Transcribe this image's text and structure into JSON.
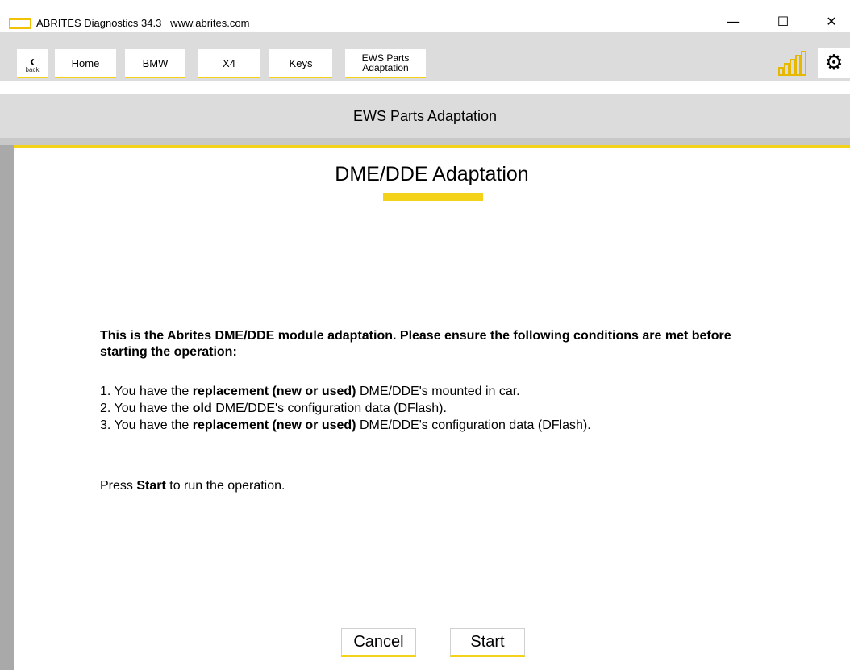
{
  "window": {
    "title": "ABRITES Diagnostics 34.3   www.abrites.com",
    "minimize": "—",
    "maximize": "☐",
    "close": "✕"
  },
  "nav": {
    "back_label": "back",
    "items": [
      "Home",
      "BMW",
      "X4",
      "Keys",
      "EWS Parts Adaptation"
    ],
    "ews_line1": "EWS Parts",
    "ews_line2": "Adaptation",
    "accent_color": "#f5d21a"
  },
  "section": {
    "header": "EWS Parts Adaptation"
  },
  "main": {
    "title": "DME/DDE Adaptation",
    "intro": "This is the Abrites DME/DDE module adaptation. Please ensure the following conditions are met before starting the operation:",
    "conditions": [
      {
        "prefix": "1. You have the ",
        "bold": "replacement (new or used)",
        "suffix": " DME/DDE's mounted in car."
      },
      {
        "prefix": "2. You have the ",
        "bold": "old",
        "suffix": " DME/DDE's configuration data (DFlash)."
      },
      {
        "prefix": "3. You have the ",
        "bold": "replacement (new or used)",
        "suffix": " DME/DDE's configuration data (DFlash)."
      }
    ],
    "press": {
      "prefix": "Press ",
      "bold": "Start",
      "suffix": " to run the operation."
    },
    "cancel_label": "Cancel",
    "start_label": "Start"
  },
  "icons": {
    "signal": "signal-strength-icon",
    "settings": "gear-icon",
    "back": "chevron-left-icon"
  }
}
